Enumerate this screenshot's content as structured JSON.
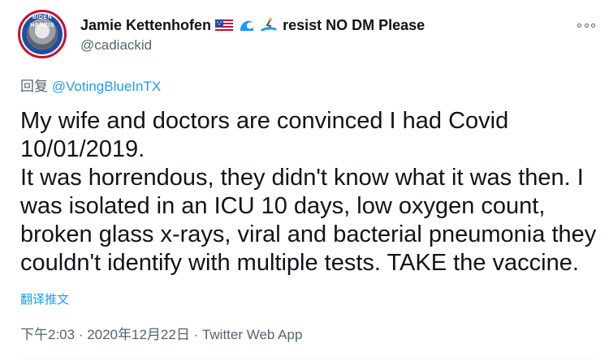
{
  "author": {
    "display_name": "Jamie Kettenhofen",
    "display_name_suffix": "resist NO DM Please",
    "handle": "@cadiackid",
    "avatar_text": "BIDEN HARRIS",
    "emoji_icons": [
      "us-flag-icon",
      "wave-icon",
      "surfer-icon"
    ]
  },
  "reply": {
    "prefix": "回复",
    "mention": "@VotingBlueInTX"
  },
  "tweet": {
    "lines": [
      "My wife and doctors are convinced I had Covid",
      "10/01/2019.",
      "It was horrendous, they didn't know what it was then. I",
      "was isolated in an ICU 10 days, low oxygen count,",
      "broken glass x-rays, viral and bacterial pneumonia they",
      "couldn't identify with multiple tests. TAKE the vaccine."
    ],
    "translate_label": "翻译推文",
    "timestamp": "下午2:03 · 2020年12月22日 · Twitter Web App"
  },
  "colors": {
    "link": "#1d9bf0",
    "secondary_text": "#536471",
    "primary_text": "#0f1419"
  }
}
